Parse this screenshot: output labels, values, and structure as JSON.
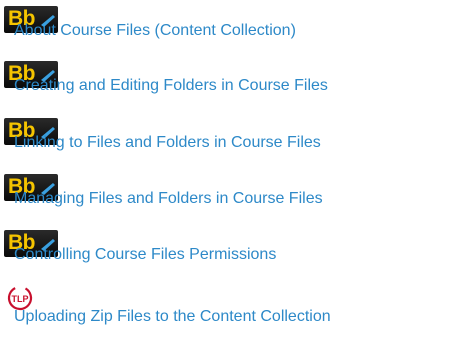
{
  "links": [
    {
      "label": "About Course Files (Content Collection)",
      "icon": "blackboard-logo-icon",
      "icon_text": "Bb"
    },
    {
      "label": "Creating and Editing Folders in Course Files",
      "icon": "blackboard-logo-icon",
      "icon_text": "Bb"
    },
    {
      "label": "Linking to Files and Folders in Course Files",
      "icon": "blackboard-logo-icon",
      "icon_text": "Bb"
    },
    {
      "label": "Managing Files and Folders in Course Files",
      "icon": "blackboard-logo-icon",
      "icon_text": "Bb"
    },
    {
      "label": "Controlling Course Files Permissions",
      "icon": "blackboard-logo-icon",
      "icon_text": "Bb"
    },
    {
      "label": "Uploading Zip Files to the Content Collection",
      "icon": "tlp-logo-icon",
      "icon_text": "TLP"
    }
  ],
  "colors": {
    "link": "#2d89c8",
    "bb_background": "#111111",
    "bb_text": "#f5c400",
    "tlp_red": "#c8102e"
  }
}
